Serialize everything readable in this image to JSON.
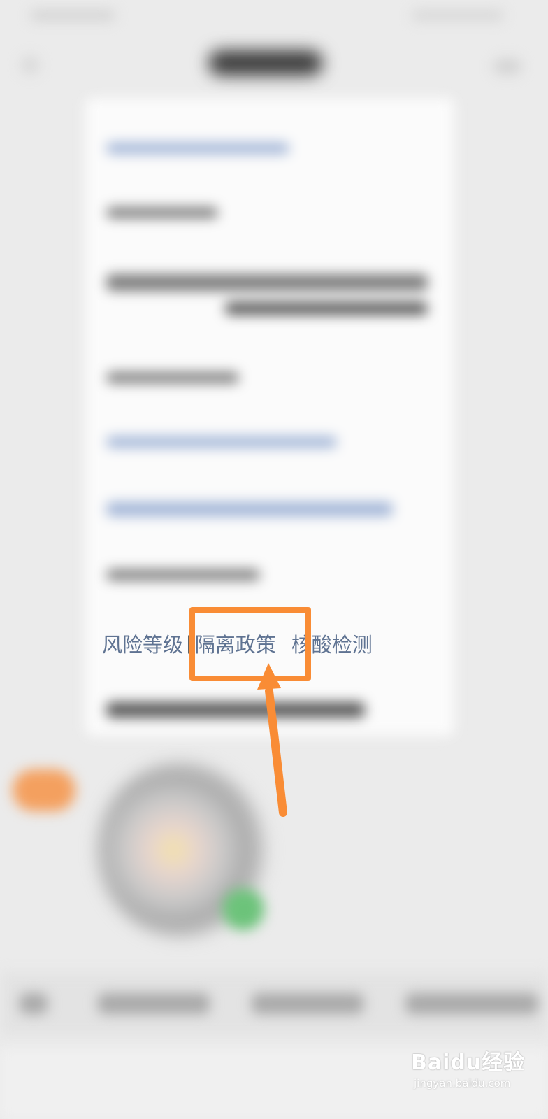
{
  "links": {
    "risk_level": "风险等级",
    "separator_1": "|",
    "quarantine_policy": "隔离政策",
    "nucleic_test": "核酸检测"
  },
  "annotation": {
    "color": "#f98c35",
    "highlight_target": "quarantine_policy",
    "arrow_icon": "arrow-up-icon"
  },
  "watermark": {
    "main": "Baidu经验",
    "sub": "jingyan.baidu.com"
  },
  "colors": {
    "link": "#5f7392",
    "background": "#ebebeb",
    "card": "#fbfbfb"
  }
}
